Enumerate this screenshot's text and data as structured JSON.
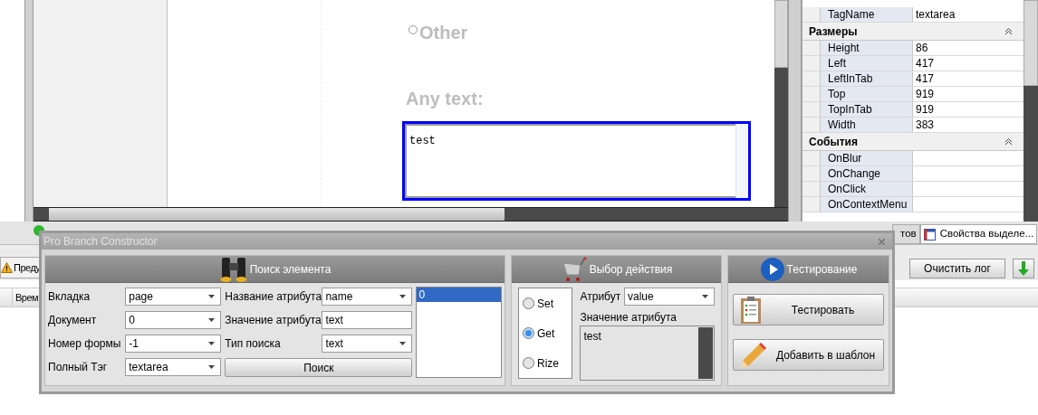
{
  "browser_page": {
    "radio_option": {
      "label": "Other",
      "selected": false
    },
    "field_label": "Any text:",
    "textarea": {
      "value": "test"
    }
  },
  "properties": {
    "rows": [
      {
        "kind": "row",
        "name": "TagName",
        "value": "textarea"
      },
      {
        "kind": "section",
        "name": "Размеры",
        "expanded": true
      },
      {
        "kind": "row",
        "name": "Height",
        "value": "86"
      },
      {
        "kind": "row",
        "name": "Left",
        "value": "417"
      },
      {
        "kind": "row",
        "name": "LeftInTab",
        "value": "417"
      },
      {
        "kind": "row",
        "name": "Top",
        "value": "919"
      },
      {
        "kind": "row",
        "name": "TopInTab",
        "value": "919"
      },
      {
        "kind": "row",
        "name": "Width",
        "value": "383"
      },
      {
        "kind": "section",
        "name": "События",
        "expanded": true
      },
      {
        "kind": "row",
        "name": "OnBlur"
      },
      {
        "kind": "row",
        "name": "OnChange"
      },
      {
        "kind": "row",
        "name": "OnClick"
      },
      {
        "kind": "row",
        "name": "OnContextMenu"
      }
    ]
  },
  "bottom_tabs": [
    {
      "label": "тов",
      "selected": false
    },
    {
      "label": "Свойства выделе...",
      "selected": true
    }
  ],
  "log": {
    "warnings_button": "Преду",
    "clear_button": "Очистить лог",
    "column_1": "Врем"
  },
  "dialog": {
    "title": "Pro Branch Constructor",
    "search": {
      "title": "Поиск элемента",
      "left_fields": [
        {
          "label": "Вкладка",
          "value": "page",
          "kind": "select"
        },
        {
          "label": "Документ",
          "value": "0",
          "kind": "select"
        },
        {
          "label": "Номер формы",
          "value": "-1",
          "kind": "select"
        },
        {
          "label": "Полный Тэг",
          "value": "textarea",
          "kind": "select"
        }
      ],
      "right_fields": [
        {
          "label": "Название атрибута",
          "value": "name",
          "kind": "select"
        },
        {
          "label": "Значение атрибута",
          "value": "text",
          "kind": "input"
        },
        {
          "label": "Тип поиска",
          "value": "text",
          "kind": "select"
        }
      ],
      "button": "Поиск",
      "results": [
        {
          "label": "0",
          "selected": true
        }
      ]
    },
    "action": {
      "title": "Выбор действия",
      "modes": [
        {
          "label": "Set",
          "selected": false
        },
        {
          "label": "Get",
          "selected": true
        },
        {
          "label": "Rize",
          "selected": false
        }
      ],
      "attribute": {
        "label": "Атрибут",
        "value": "value"
      },
      "attribute_value": {
        "label": "Значение атрибута",
        "value": "test"
      }
    },
    "testing": {
      "title": "Тестирование",
      "buttons": [
        {
          "label": "Тестировать",
          "kind": "test"
        },
        {
          "label": "Добавить в шаблон",
          "kind": "template"
        }
      ]
    }
  }
}
